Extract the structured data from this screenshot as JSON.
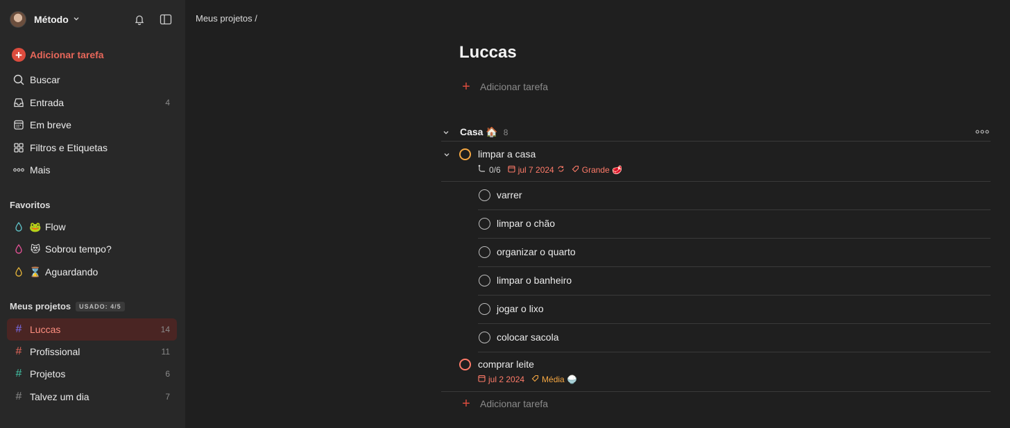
{
  "sidebar": {
    "workspace": "Método",
    "add_task": "Adicionar tarefa",
    "nav": [
      {
        "label": "Buscar",
        "count": ""
      },
      {
        "label": "Entrada",
        "count": "4"
      },
      {
        "label": "Em breve",
        "count": ""
      },
      {
        "label": "Filtros e Etiquetas",
        "count": ""
      },
      {
        "label": "Mais",
        "count": ""
      }
    ],
    "favorites_title": "Favoritos",
    "favorites": [
      {
        "emoji": "🐸",
        "label": "Flow",
        "color": "#5fc0c6"
      },
      {
        "emoji": "😻",
        "label": "Sobrou tempo?",
        "color": "#e05194"
      },
      {
        "emoji": "⌛",
        "label": "Aguardando",
        "color": "#e0b13a"
      }
    ],
    "projects_title": "Meus projetos",
    "usage": "USADO: 4/5",
    "projects": [
      {
        "label": "Luccas",
        "count": "14",
        "color": "#7a6ff0"
      },
      {
        "label": "Profissional",
        "count": "11",
        "color": "#e8675a"
      },
      {
        "label": "Projetos",
        "count": "6",
        "color": "#42c2a5"
      },
      {
        "label": "Talvez um dia",
        "count": "7",
        "color": "#8a8a8a"
      }
    ]
  },
  "main": {
    "breadcrumb": "Meus projetos /",
    "title": "Luccas",
    "add_task": "Adicionar tarefa",
    "section": {
      "name": "Casa 🏠",
      "count": "8"
    },
    "parent_task": {
      "name": "limpar a casa",
      "subtasks": "0/6",
      "date": "jul 7 2024",
      "tag": "Grande 🥩"
    },
    "subtasks": [
      "varrer",
      "limpar o chão",
      "organizar o quarto",
      "limpar o banheiro",
      "jogar o lixo",
      "colocar sacola"
    ],
    "task2": {
      "name": "comprar leite",
      "date": "jul 2 2024",
      "tag": "Média 🍚"
    },
    "add_task_bottom": "Adicionar tarefa"
  }
}
